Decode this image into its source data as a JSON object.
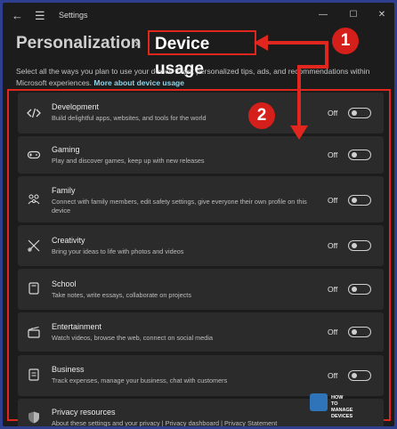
{
  "window": {
    "title": "Settings",
    "controls": {
      "minimize": "—",
      "maximize": "☐",
      "close": "✕"
    }
  },
  "breadcrumb": {
    "parent": "Personalization",
    "separator": "›",
    "current": "Device usage"
  },
  "description": {
    "text": "Select all the ways you plan to use your device to get personalized tips, ads, and recommendations within Microsoft experiences.",
    "link": "More about device usage"
  },
  "items": [
    {
      "title": "Development",
      "subtitle": "Build delightful apps, websites, and tools for the world",
      "state": "Off",
      "icon": "code-icon"
    },
    {
      "title": "Gaming",
      "subtitle": "Play and discover games, keep up with new releases",
      "state": "Off",
      "icon": "gamepad-icon"
    },
    {
      "title": "Family",
      "subtitle": "Connect with family members, edit safety settings, give everyone their own profile on this device",
      "state": "Off",
      "icon": "family-icon"
    },
    {
      "title": "Creativity",
      "subtitle": "Bring your ideas to life with photos and videos",
      "state": "Off",
      "icon": "creativity-icon"
    },
    {
      "title": "School",
      "subtitle": "Take notes, write essays, collaborate on projects",
      "state": "Off",
      "icon": "notebook-icon"
    },
    {
      "title": "Entertainment",
      "subtitle": "Watch videos, browse the web, connect on social media",
      "state": "Off",
      "icon": "clapper-icon"
    },
    {
      "title": "Business",
      "subtitle": "Track expenses, manage your business, chat with customers",
      "state": "Off",
      "icon": "briefcase-icon"
    },
    {
      "title": "Privacy resources",
      "subtitle": "About these settings and your privacy | Privacy dashboard | Privacy Statement",
      "icon": "shield-icon"
    }
  ],
  "annotations": {
    "badge1": "1",
    "badge2": "2"
  },
  "watermark": {
    "line1": "HOW",
    "line2": "TO",
    "line3": "MANAGE",
    "line4": "DEVICES"
  },
  "colors": {
    "accent": "#e0261d",
    "link": "#8fd3e8",
    "background": "#1c1c1c",
    "card": "#2b2b2b"
  }
}
